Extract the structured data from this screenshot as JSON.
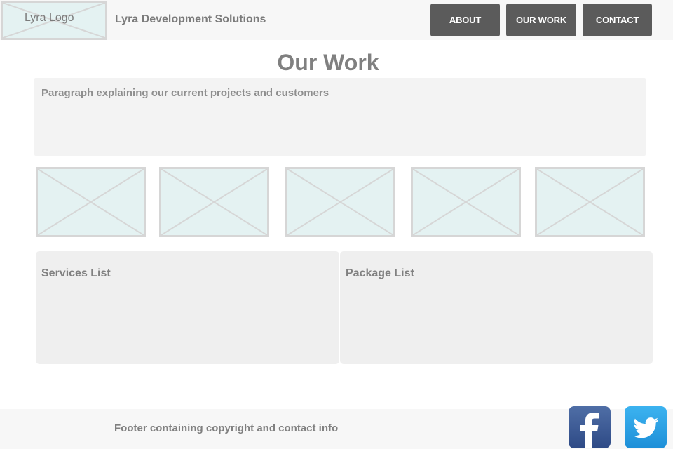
{
  "header": {
    "logo_label": "Lyra Logo",
    "site_title": "Lyra Development Solutions",
    "nav": {
      "about": "ABOUT",
      "our_work": "OUR WORK",
      "contact": "CONTACT"
    }
  },
  "main": {
    "heading": "Our Work",
    "intro_text": "Paragraph explaining our current projects and customers",
    "services_title": "Services List",
    "packages_title": "Package List"
  },
  "footer": {
    "text": "Footer containing copyright and contact info",
    "social": {
      "facebook_icon": "facebook-icon",
      "twitter_icon": "twitter-icon"
    }
  },
  "colors": {
    "nav_button": "#5b5b5b",
    "placeholder_fill": "#e4f2f2",
    "placeholder_border": "#d6d6d6",
    "facebook": "#3b5998",
    "twitter": "#1da1f2"
  }
}
